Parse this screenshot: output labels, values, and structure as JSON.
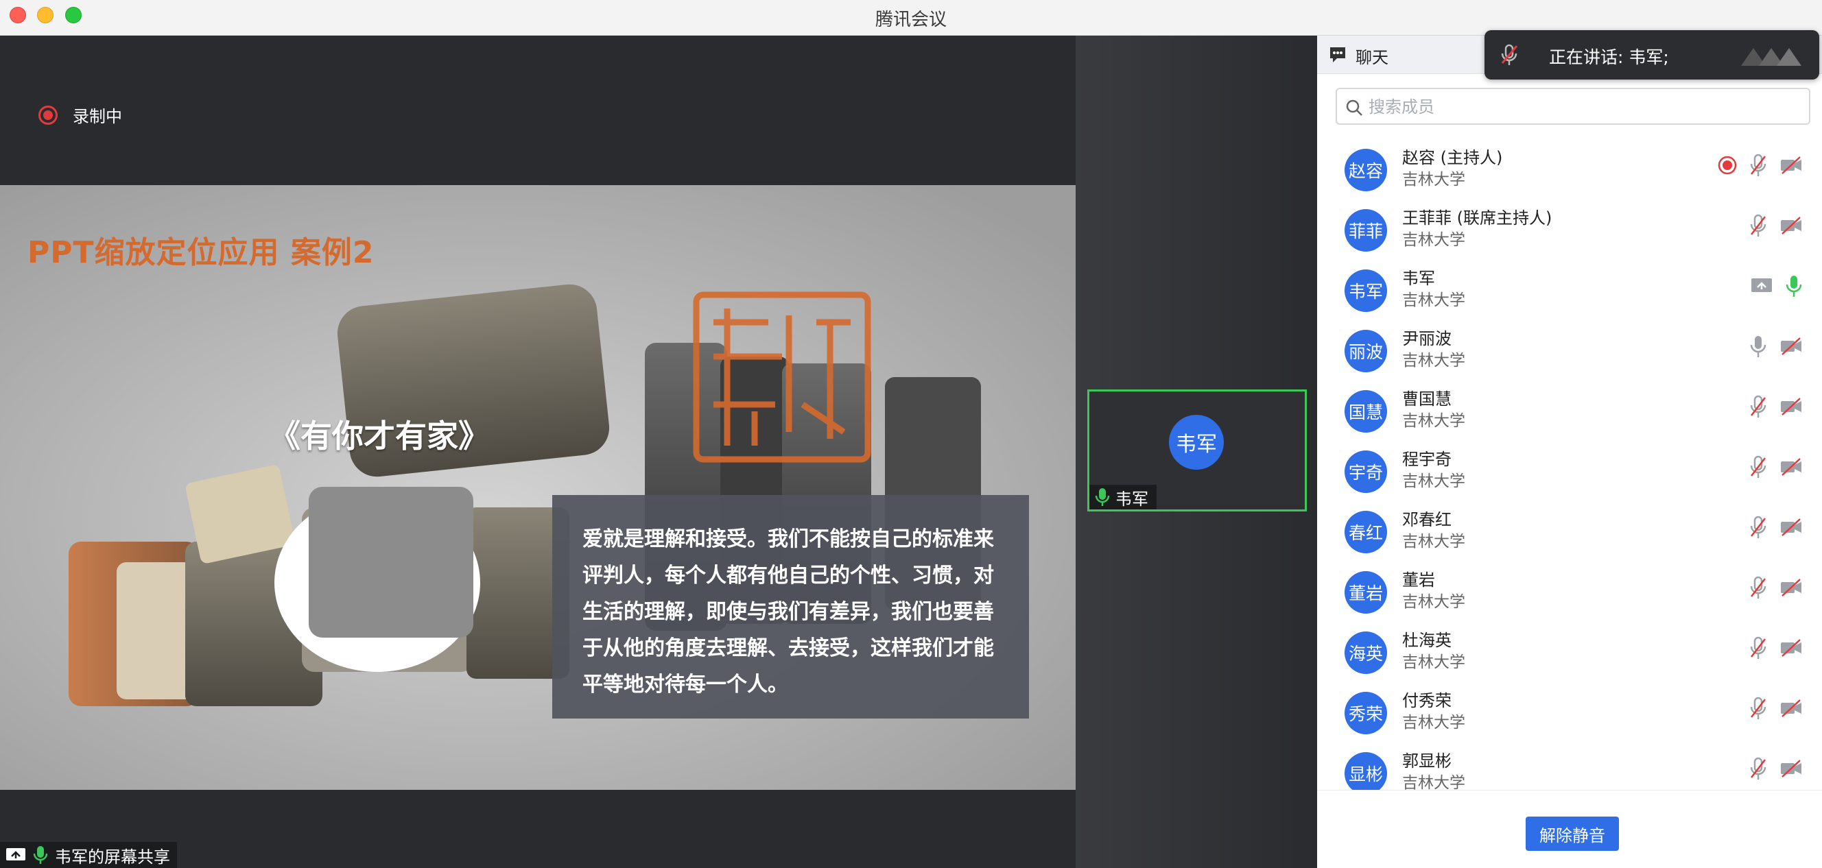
{
  "window": {
    "title": "腾讯会议"
  },
  "recording": {
    "label": "录制中"
  },
  "slide": {
    "title": "PPT缩放定位应用 案例2",
    "subtitle": "《有你才有家》",
    "body": "爱就是理解和接受。我们不能按自己的标准来评判人，每个人都有他自己的个性、习惯，对生活的理解，即使与我们有差异，我们也要善于从他的角度去理解、去接受，这样我们才能平等地对待每一个人。",
    "seal_text": "有你才有家"
  },
  "share_bar": {
    "label": "韦军的屏幕共享"
  },
  "video_tile": {
    "avatar": "韦军",
    "name": "韦军"
  },
  "panel": {
    "chat_tab": "聊天",
    "speaking_toast": "正在讲话: 韦军;",
    "search_placeholder": "搜索成员",
    "members": [
      {
        "avatar": "赵容",
        "name": "赵容 (主持人)",
        "org": "吉林大学",
        "recording": true,
        "mic": "muted",
        "video": "off"
      },
      {
        "avatar": "菲菲",
        "name": "王菲菲 (联席主持人)",
        "org": "吉林大学",
        "mic": "muted",
        "video": "off"
      },
      {
        "avatar": "韦军",
        "name": "韦军",
        "org": "吉林大学",
        "sharing": true,
        "mic": "on"
      },
      {
        "avatar": "丽波",
        "name": "尹丽波",
        "org": "吉林大学",
        "mic": "available",
        "video": "off"
      },
      {
        "avatar": "国慧",
        "name": "曹国慧",
        "org": "吉林大学",
        "mic": "muted",
        "video": "off"
      },
      {
        "avatar": "宇奇",
        "name": "程宇奇",
        "org": "吉林大学",
        "mic": "muted",
        "video": "off"
      },
      {
        "avatar": "春红",
        "name": "邓春红",
        "org": "吉林大学",
        "mic": "muted",
        "video": "off"
      },
      {
        "avatar": "董岩",
        "name": "董岩",
        "org": "吉林大学",
        "mic": "muted",
        "video": "off"
      },
      {
        "avatar": "海英",
        "name": "杜海英",
        "org": "吉林大学",
        "mic": "muted",
        "video": "off"
      },
      {
        "avatar": "秀荣",
        "name": "付秀荣",
        "org": "吉林大学",
        "mic": "muted",
        "video": "off"
      },
      {
        "avatar": "显彬",
        "name": "郭显彬",
        "org": "吉林大学",
        "mic": "muted",
        "video": "off"
      }
    ],
    "unmute_all": "解除静音"
  },
  "colors": {
    "accent": "#2f6ee6",
    "active_border": "#3cc75a",
    "recording": "#e23b3b",
    "mic_on": "#3cc75a",
    "muted_red": "#e23b3b"
  }
}
